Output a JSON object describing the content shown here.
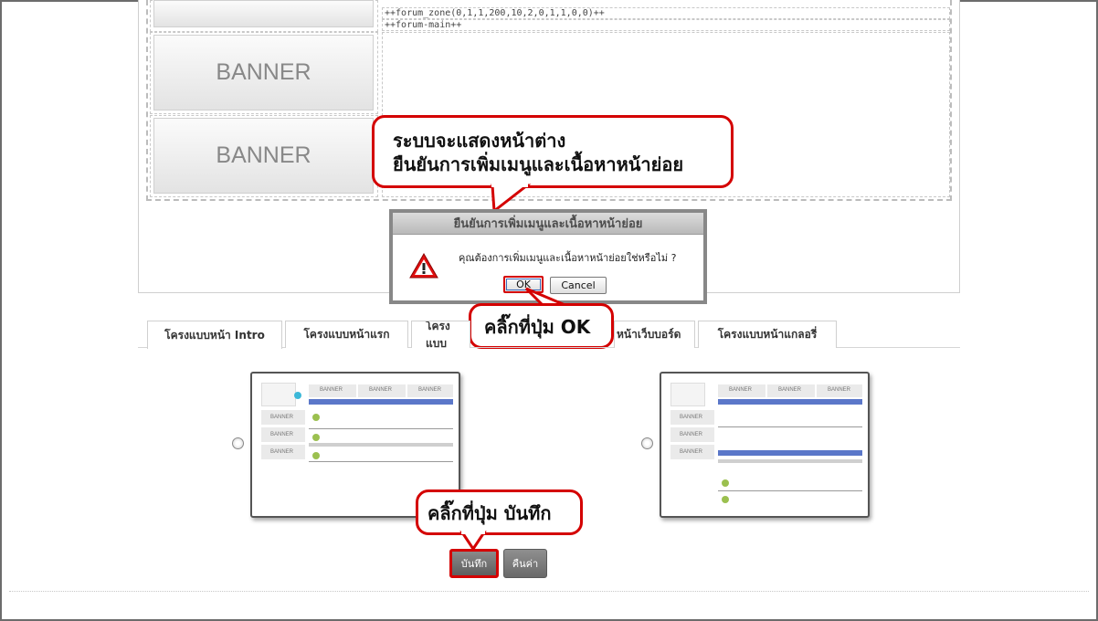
{
  "layout": {
    "code_lines": [
      "++forum_zone(0,1,1,200,10,2,0,1,1,0,0)++",
      "++forum-main++"
    ],
    "banners": [
      "BANNER",
      "BANNER"
    ]
  },
  "callouts": {
    "dialog_note_line1": "ระบบจะแสดงหน้าต่าง",
    "dialog_note_line2": "ยืนยันการเพิ่มเมนูและเนื้อหาหน้าย่อย",
    "click_ok": "คลิ๊กที่ปุ่ม OK",
    "click_save": "คลิ๊กที่ปุ่ม บันทึก"
  },
  "dialog": {
    "title": "ยืนยันการเพิ่มเมนูและเนื้อหาหน้าย่อย",
    "message": "คุณต้องการเพิ่มเมนูและเนื้อหาหน้าย่อยใช่หรือไม่ ?",
    "ok_label": "OK",
    "cancel_label": "Cancel",
    "icon": "warning-icon"
  },
  "tabs": [
    {
      "label": "โครงแบบหน้า Intro"
    },
    {
      "label": "โครงแบบหน้าแรก"
    },
    {
      "label": "โครงแบบ"
    },
    {
      "label": "หน้าเว็บบอร์ด"
    },
    {
      "label": "โครงแบบหน้าแกลอรี่"
    }
  ],
  "thumbnails": {
    "banner_label": "BANNER"
  },
  "actions": {
    "save_label": "บันทึก",
    "reset_label": "คืนค่า"
  },
  "colors": {
    "callout_border": "#d40000",
    "save_button": "#6b6b6b",
    "reset_button": "#7a7a7a",
    "thumb_header_blue": "#5b77c9"
  }
}
